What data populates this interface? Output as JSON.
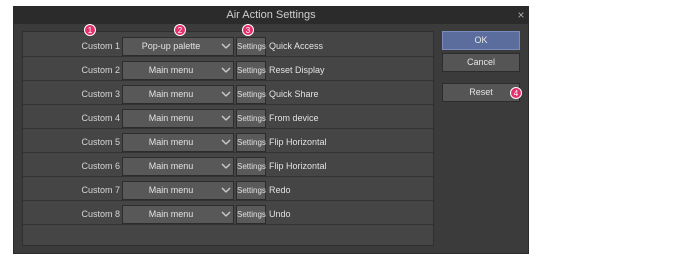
{
  "dialog": {
    "title": "Air Action Settings",
    "close_glyph": "×"
  },
  "rows": [
    {
      "label": "Custom 1",
      "dropdown": "Pop-up palette",
      "settings": "Settings",
      "action": "Quick Access"
    },
    {
      "label": "Custom 2",
      "dropdown": "Main menu",
      "settings": "Settings",
      "action": "Reset Display"
    },
    {
      "label": "Custom 3",
      "dropdown": "Main menu",
      "settings": "Settings",
      "action": "Quick Share"
    },
    {
      "label": "Custom 4",
      "dropdown": "Main menu",
      "settings": "Settings",
      "action": "From device"
    },
    {
      "label": "Custom 5",
      "dropdown": "Main menu",
      "settings": "Settings",
      "action": "Flip Horizontal"
    },
    {
      "label": "Custom 6",
      "dropdown": "Main menu",
      "settings": "Settings",
      "action": "Flip Horizontal"
    },
    {
      "label": "Custom 7",
      "dropdown": "Main menu",
      "settings": "Settings",
      "action": "Redo"
    },
    {
      "label": "Custom 8",
      "dropdown": "Main menu",
      "settings": "Settings",
      "action": "Undo"
    }
  ],
  "buttons": {
    "ok": "OK",
    "cancel": "Cancel",
    "reset": "Reset"
  },
  "callouts": [
    "1",
    "2",
    "3",
    "4"
  ],
  "colors": {
    "accent": "#5b6d9c",
    "callout": "#e2306c"
  }
}
